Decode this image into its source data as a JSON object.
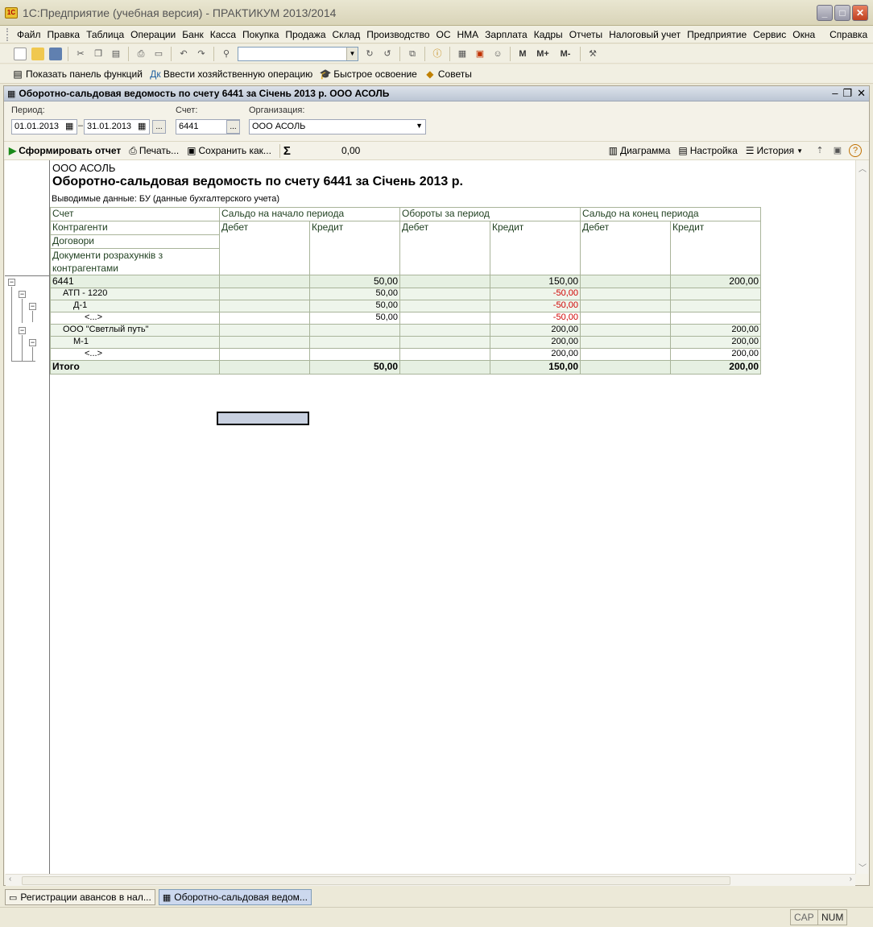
{
  "window": {
    "title": "1С:Предприятие (учебная версия) - ПРАКТИКУМ 2013/2014",
    "logo_text": "1С"
  },
  "menu": [
    "Файл",
    "Правка",
    "Таблица",
    "Операции",
    "Банк",
    "Касса",
    "Покупка",
    "Продажа",
    "Склад",
    "Производство",
    "ОС",
    "НМА",
    "Зарплата",
    "Кадры",
    "Отчеты",
    "Налоговый учет",
    "Предприятие",
    "Сервис",
    "Окна",
    "Справка"
  ],
  "toolbar": {
    "icons": [
      "new-icon",
      "open-icon",
      "save-icon",
      "cut-icon",
      "copy-icon",
      "paste-icon",
      "print-icon",
      "preview-icon",
      "undo-icon",
      "redo-icon",
      "find-icon"
    ],
    "right_icons": [
      "find-next-icon",
      "find-prev-icon",
      "windows-icon",
      "info-icon",
      "calculator-icon",
      "calendar-icon",
      "users-icon"
    ],
    "m": "M",
    "m_plus": "M+",
    "m_minus": "M-"
  },
  "toolbar2": {
    "show_panel": "Показать панель функций",
    "enter_op": "Ввести хозяйственную операцию",
    "quick_learn": "Быстрое освоение",
    "tips": "Советы"
  },
  "doc": {
    "title": "Оборотно-сальдовая ведомость по счету 6441 за Січень 2013 р. ООО АСОЛЬ",
    "period_label": "Период:",
    "date_from": "01.01.2013",
    "date_to": "31.01.2013",
    "dash": "–",
    "account_label": "Счет:",
    "account": "6441",
    "org_label": "Организация:",
    "org": "ООО АСОЛЬ",
    "dots": "...",
    "cmd": {
      "generate": "Сформировать отчет",
      "print": "Печать...",
      "save_as": "Сохранить как...",
      "sum_symbol": "Σ",
      "sum_value": "0,00",
      "diagram": "Диаграмма",
      "settings": "Настройка",
      "history": "История"
    }
  },
  "report": {
    "org": "ООО АСОЛЬ",
    "title": "Оборотно-сальдовая ведомость по счету 6441 за Січень 2013 р.",
    "subtitle": "Выводимые данные:  БУ (данные бухгалтерского учета)",
    "headers": {
      "account": "Счет",
      "counterparties": "Контрагенти",
      "contracts": "Договори",
      "documents": "Документи розрахунків з контрагентами",
      "opening": "Сальдо на начало периода",
      "turnover": "Обороты за период",
      "closing": "Сальдо на конец периода",
      "debit": "Дебет",
      "credit": "Кредит"
    },
    "rows": [
      {
        "name": "6441",
        "c1": "",
        "c2": "50,00",
        "c3": "",
        "c4": "150,00",
        "c5": "",
        "c6": "200,00"
      },
      {
        "name": "АТП - 1220",
        "c1": "",
        "c2": "50,00",
        "c3": "",
        "c4": "-50,00",
        "c5": "",
        "c6": ""
      },
      {
        "name": "Д-1",
        "c1": "",
        "c2": "50,00",
        "c3": "",
        "c4": "-50,00",
        "c5": "",
        "c6": ""
      },
      {
        "name": "<...>",
        "c1": "",
        "c2": "50,00",
        "c3": "",
        "c4": "-50,00",
        "c5": "",
        "c6": ""
      },
      {
        "name": "ООО \"Светлый путь\"",
        "c1": "",
        "c2": "",
        "c3": "",
        "c4": "200,00",
        "c5": "",
        "c6": "200,00"
      },
      {
        "name": "М-1",
        "c1": "",
        "c2": "",
        "c3": "",
        "c4": "200,00",
        "c5": "",
        "c6": "200,00"
      },
      {
        "name": "<...>",
        "c1": "",
        "c2": "",
        "c3": "",
        "c4": "200,00",
        "c5": "",
        "c6": "200,00"
      }
    ],
    "total": {
      "name": "Итого",
      "c1": "",
      "c2": "50,00",
      "c3": "",
      "c4": "150,00",
      "c5": "",
      "c6": "200,00"
    },
    "colors": {
      "group_bg": "#E6F0E2",
      "negative": "#D00000",
      "border": "#A9B49A"
    }
  },
  "taskbar": {
    "task1": "Регистрации авансов в нал...",
    "task2": "Оборотно-сальдовая ведом..."
  },
  "status": {
    "cap": "CAP",
    "num": "NUM"
  }
}
